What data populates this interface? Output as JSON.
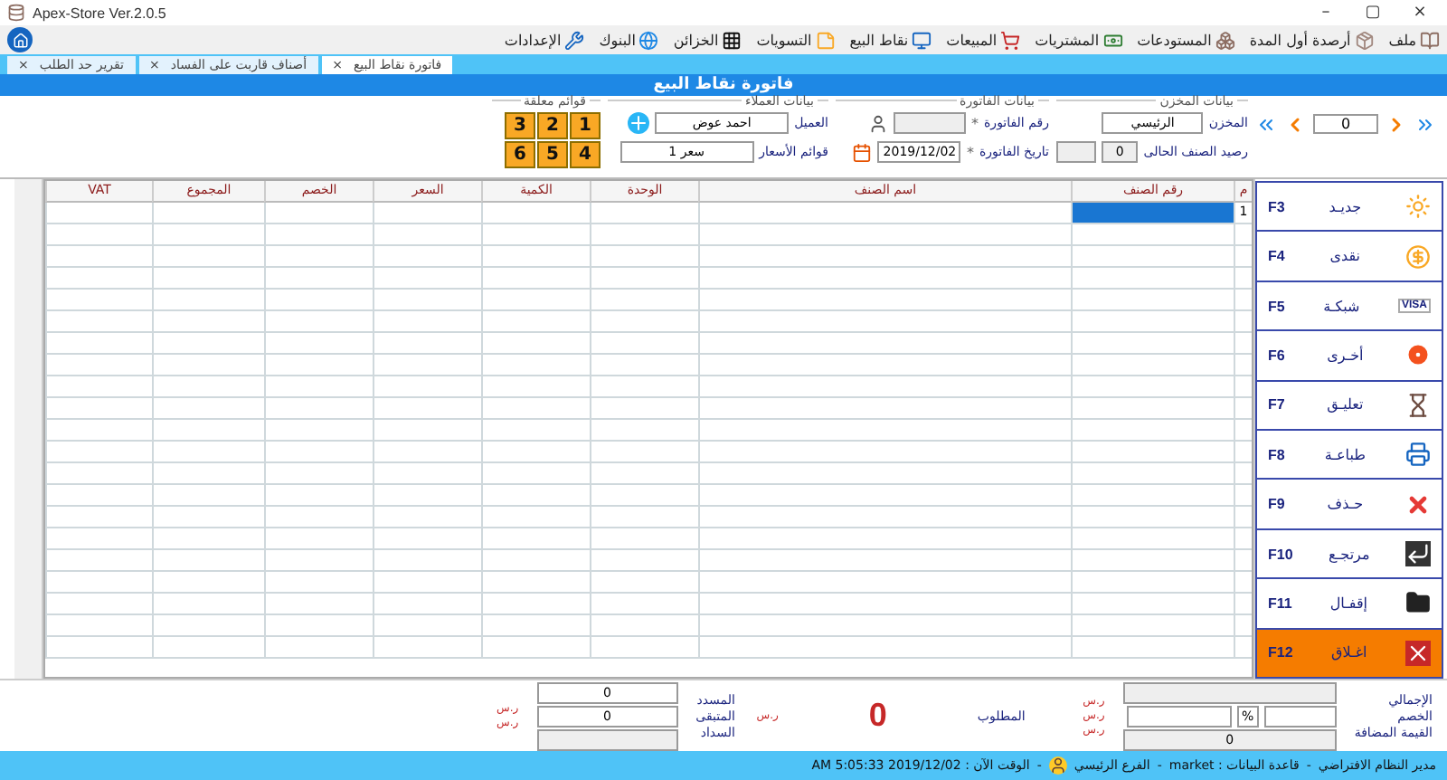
{
  "window": {
    "title": "Apex-Store Ver.2.0.5",
    "minimize": "–",
    "maximize": "▢",
    "close": "×"
  },
  "menu": [
    {
      "label": "ملف"
    },
    {
      "label": "أرصدة أول المدة"
    },
    {
      "label": "المستودعات"
    },
    {
      "label": "المشتريات"
    },
    {
      "label": "المبيعات"
    },
    {
      "label": "نقاط البيع"
    },
    {
      "label": "التسويات"
    },
    {
      "label": "الخزائن"
    },
    {
      "label": "البنوك"
    },
    {
      "label": "الإعدادات"
    }
  ],
  "tabs": [
    {
      "label": "فاتورة نقاط البيع",
      "close": "×",
      "selected": true
    },
    {
      "label": "أصناف قاربت على الفساد",
      "close": "×",
      "selected": false
    },
    {
      "label": "تقرير حد الطلب",
      "close": "×",
      "selected": false
    }
  ],
  "heading": "فاتورة نقاط البيع",
  "nav": {
    "value": "0"
  },
  "store": {
    "title": "بيانات المخزن",
    "store_label": "المخزن",
    "store_value": "الرئيسي",
    "balance_label": "رصيد الصنف الحالى",
    "balance_value": "0"
  },
  "invoice": {
    "title": "بيانات الفاتورة",
    "number_label": "رقم الفاتورة",
    "date_label": "تاريخ الفاتورة",
    "required": "*",
    "date_value": "2019/12/02"
  },
  "customer": {
    "title": "بيانات العملاء",
    "customer_label": "العميل",
    "customer_value": "احمد عوض",
    "price_label": "قوائم الأسعار",
    "price_value": "سعر 1"
  },
  "held": {
    "title": "قوائم معلقة",
    "items": [
      "1",
      "2",
      "3",
      "4",
      "5",
      "6"
    ]
  },
  "table": {
    "columns": [
      "م",
      "رقم الصنف",
      "اسم الصنف",
      "الوحدة",
      "الكمية",
      "السعر",
      "الخصم",
      "المجموع",
      "VAT"
    ],
    "rows": [
      {
        "cells": [
          {
            "text": "1",
            "selected": false
          },
          {
            "selected": true
          },
          {
            "selected": false
          },
          {
            "selected": false
          },
          {
            "selected": false
          },
          {
            "selected": false
          },
          {
            "selected": false
          },
          {
            "selected": false
          },
          {
            "selected": false
          }
        ]
      }
    ]
  },
  "actions": [
    {
      "label": "جديـد",
      "key": "F3",
      "accent": false
    },
    {
      "label": "نقدى",
      "key": "F4",
      "accent": false
    },
    {
      "label": "شبكـة",
      "key": "F5",
      "accent": false,
      "badge": "VISA"
    },
    {
      "label": "أخـرى",
      "key": "F6",
      "accent": false
    },
    {
      "label": "تعليـق",
      "key": "F7",
      "accent": false
    },
    {
      "label": "طباعـة",
      "key": "F8",
      "accent": false
    },
    {
      "label": "حـذف",
      "key": "F9",
      "accent": false
    },
    {
      "label": "مرتجـع",
      "key": "F10",
      "accent": false
    },
    {
      "label": "إقفـال",
      "key": "F11",
      "accent": false
    },
    {
      "label": "اغـلاق",
      "key": "F12",
      "accent": true
    }
  ],
  "totals": {
    "total_label": "الإجمالي",
    "discount_label": "الخصم",
    "percent": "%",
    "vat_label": "القيمة المضافة",
    "vat_value": "0",
    "currency": [
      "ر.س",
      "ر.س",
      "ر.س"
    ]
  },
  "due": {
    "label": "المطلوب",
    "value": "0",
    "currency": "ر.س"
  },
  "payments": [
    {
      "label": "المسدد",
      "value": "0",
      "currency": "ر.س"
    },
    {
      "label": "المتبقى",
      "value": "0",
      "currency": "ر.س"
    },
    {
      "label": "السداد"
    }
  ],
  "status_bar": {
    "separator": "-",
    "user": "مدير النظام الافتراضي",
    "database": "قاعدة البيانات : market",
    "branch": "الفرع الرئيسي",
    "time": "الوقت الآن : 2019/12/02 5:05:33 AM"
  }
}
